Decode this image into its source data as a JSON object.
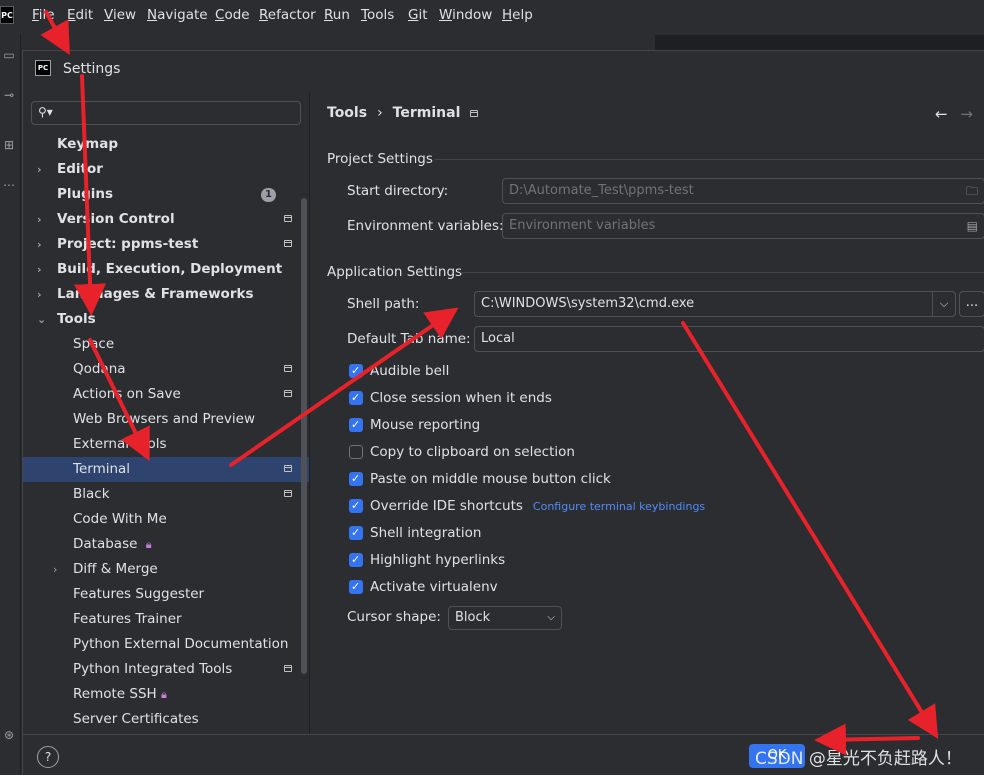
{
  "menubar": {
    "app_logo": "PC",
    "items": [
      {
        "label": "File",
        "u": "F",
        "rest": "ile"
      },
      {
        "label": "Edit",
        "u": "E",
        "rest": "dit"
      },
      {
        "label": "View",
        "u": "V",
        "rest": "iew"
      },
      {
        "label": "Navigate",
        "u": "N",
        "rest": "avigate"
      },
      {
        "label": "Code",
        "u": "C",
        "rest": "ode"
      },
      {
        "label": "Refactor",
        "u": "R",
        "rest": "efactor"
      },
      {
        "label": "Run",
        "u": "R",
        "rest": "un"
      },
      {
        "label": "Tools",
        "u": "T",
        "rest": "ools"
      },
      {
        "label": "Git",
        "u": "G",
        "rest": "it"
      },
      {
        "label": "Window",
        "u": "W",
        "rest": "indow"
      },
      {
        "label": "Help",
        "u": "H",
        "rest": "elp"
      }
    ]
  },
  "dialog": {
    "logo": "PC",
    "title": "Settings"
  },
  "search": {
    "placeholder": ""
  },
  "tree": {
    "items": [
      {
        "label": "Keymap",
        "level": 0,
        "bold": true
      },
      {
        "label": "Editor",
        "level": 0,
        "bold": true,
        "chevron": "right"
      },
      {
        "label": "Plugins",
        "level": 0,
        "bold": true,
        "badge": "1"
      },
      {
        "label": "Version Control",
        "level": 0,
        "bold": true,
        "chevron": "right",
        "pinned": true
      },
      {
        "label": "Project: ppms-test",
        "level": 0,
        "bold": true,
        "chevron": "right",
        "pinned": true
      },
      {
        "label": "Build, Execution, Deployment",
        "level": 0,
        "bold": true,
        "chevron": "right"
      },
      {
        "label": "Languages & Frameworks",
        "level": 0,
        "bold": true,
        "chevron": "right"
      },
      {
        "label": "Tools",
        "level": 0,
        "bold": true,
        "chevron": "down"
      },
      {
        "label": "Space",
        "level": 1
      },
      {
        "label": "Qodana",
        "level": 1,
        "pinned": true
      },
      {
        "label": "Actions on Save",
        "level": 1,
        "pinned": true
      },
      {
        "label": "Web Browsers and Preview",
        "level": 1
      },
      {
        "label": "External Tools",
        "level": 1
      },
      {
        "label": "Terminal",
        "level": 1,
        "pinned": true,
        "selected": true
      },
      {
        "label": "Black",
        "level": 1,
        "pinned": true
      },
      {
        "label": "Code With Me",
        "level": 1
      },
      {
        "label": "Database",
        "level": 1,
        "lock": true
      },
      {
        "label": "Diff & Merge",
        "level": 1,
        "chevron": "right"
      },
      {
        "label": "Features Suggester",
        "level": 1
      },
      {
        "label": "Features Trainer",
        "level": 1
      },
      {
        "label": "Python External Documentation",
        "level": 1
      },
      {
        "label": "Python Integrated Tools",
        "level": 1,
        "pinned": true
      },
      {
        "label": "Remote SSH",
        "level": 1,
        "lock": true
      },
      {
        "label": "Server Certificates",
        "level": 1
      }
    ]
  },
  "breadcrumb": {
    "parent": "Tools",
    "separator": "›",
    "current": "Terminal"
  },
  "nav": {
    "back": "←",
    "forward": "→"
  },
  "project_settings": {
    "title": "Project Settings",
    "start_directory_label": "Start directory:",
    "start_directory_value": "D:\\Automate_Test\\ppms-test",
    "env_vars_label": "Environment variables:",
    "env_vars_placeholder": "Environment variables"
  },
  "app_settings": {
    "title": "Application Settings",
    "shell_path_label": "Shell path:",
    "shell_path_value": "C:\\WINDOWS\\system32\\cmd.exe",
    "browse_label": "...",
    "tab_name_label": "Default Tab name:",
    "tab_name_value": "Local",
    "checkboxes": [
      {
        "label": "Audible bell",
        "checked": true
      },
      {
        "label": "Close session when it ends",
        "checked": true
      },
      {
        "label": "Mouse reporting",
        "checked": true
      },
      {
        "label": "Copy to clipboard on selection",
        "checked": false
      },
      {
        "label": "Paste on middle mouse button click",
        "checked": true
      },
      {
        "label": "Override IDE shortcuts",
        "checked": true,
        "link": "Configure terminal keybindings"
      },
      {
        "label": "Shell integration",
        "checked": true
      },
      {
        "label": "Highlight hyperlinks",
        "checked": true
      },
      {
        "label": "Activate virtualenv",
        "checked": true
      }
    ],
    "cursor_shape_label": "Cursor shape:",
    "cursor_shape_value": "Block"
  },
  "footer": {
    "help": "?",
    "ok": "OK"
  },
  "watermark": "CSDN @星光不负赶路人！",
  "colors": {
    "background": "#2b2d30",
    "selection": "#2e436e",
    "accent": "#3574f0",
    "annotation_arrow": "#e8222a"
  }
}
